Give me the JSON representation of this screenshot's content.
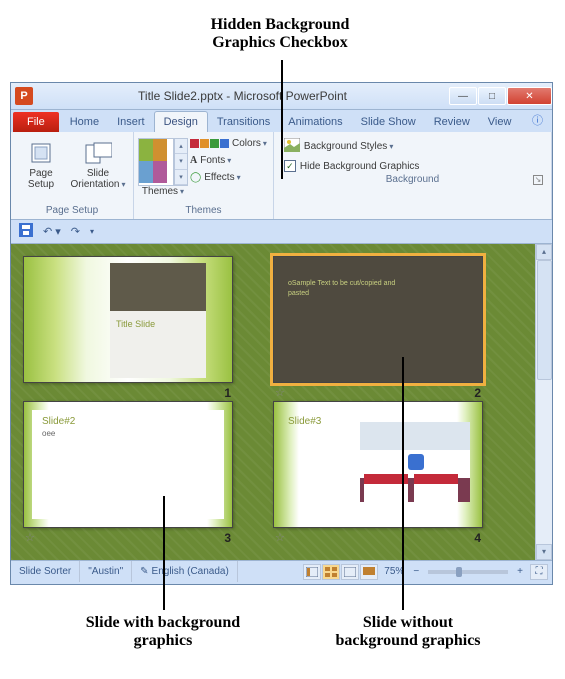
{
  "annotations": {
    "top": "Hidden Background\nGraphics Checkbox",
    "bottom_left": "Slide with background\ngraphics",
    "bottom_right": "Slide without\nbackground graphics"
  },
  "window": {
    "title": "Title Slide2.pptx - Microsoft PowerPoint",
    "app_initial": "P"
  },
  "tabs": {
    "file": "File",
    "home": "Home",
    "insert": "Insert",
    "design": "Design",
    "transitions": "Transitions",
    "animations": "Animations",
    "slideshow": "Slide Show",
    "review": "Review",
    "view": "View"
  },
  "ribbon": {
    "page_setup": {
      "label": "Page Setup",
      "btn_page_setup": "Page\nSetup",
      "btn_orientation": "Slide\nOrientation"
    },
    "themes": {
      "label": "Themes",
      "btn_themes": "Themes",
      "colors": "Colors",
      "fonts": "Fonts",
      "effects": "Effects"
    },
    "background": {
      "label": "Background",
      "styles": "Background Styles",
      "hide": "Hide Background Graphics",
      "hide_checked": true
    }
  },
  "slides": [
    {
      "num": "1",
      "title": "Title Slide",
      "layout": "title_green"
    },
    {
      "num": "2",
      "text": "oSample Text to be cut/copied and\npasted",
      "layout": "dark_hidden_bg",
      "selected": true,
      "has_star": true
    },
    {
      "num": "3",
      "title": "Slide#2",
      "body": "oee",
      "layout": "green_frame",
      "has_star": true
    },
    {
      "num": "4",
      "title": "Slide#3",
      "layout": "green_frame_pic",
      "has_star": true
    }
  ],
  "statusbar": {
    "view": "Slide Sorter",
    "theme": "\"Austin\"",
    "language": "English (Canada)",
    "zoom": "75%"
  }
}
